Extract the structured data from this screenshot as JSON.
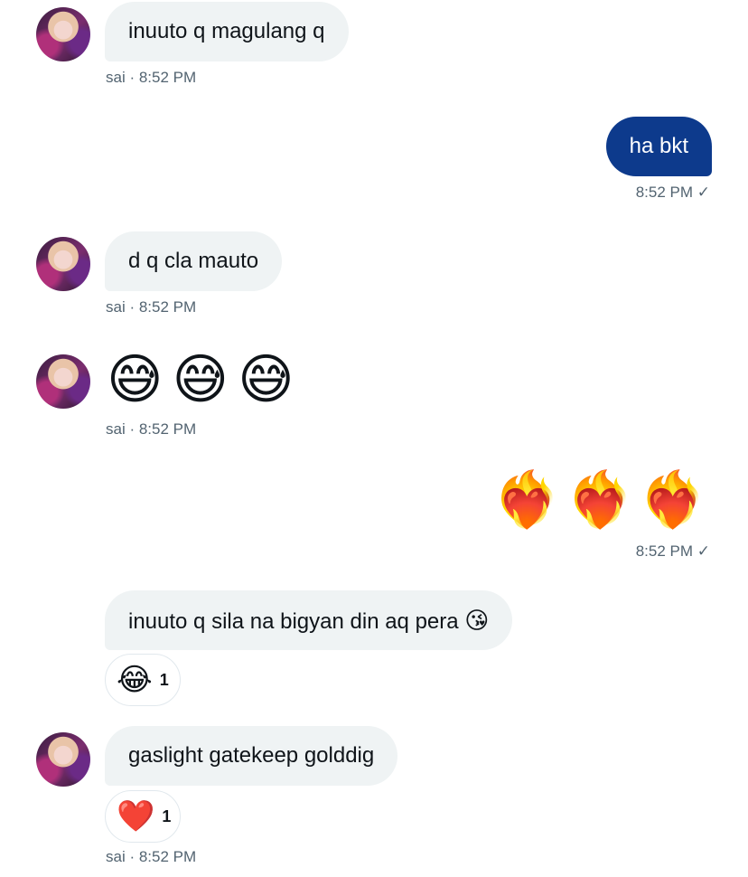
{
  "messages": [
    {
      "sender": "sai",
      "text": "inuuto q magulang q",
      "meta": "sai · 8:52 PM"
    },
    {
      "text": "ha bkt",
      "meta": "8:52 PM ✓"
    },
    {
      "sender": "sai",
      "text": "d q cla mauto",
      "meta": "sai · 8:52 PM"
    },
    {
      "sender": "sai",
      "emojis": "😅😅😅",
      "meta": "sai · 8:52 PM"
    },
    {
      "emojis": "❤️‍🔥❤️‍🔥❤️‍🔥",
      "meta": "8:52 PM ✓"
    },
    {
      "sender": "sai",
      "text": "inuuto q sila na bigyan din aq pera",
      "inline_emoji": "😘",
      "reaction": {
        "emoji": "😂",
        "count": "1"
      }
    },
    {
      "sender": "sai",
      "text": "gaslight gatekeep golddig",
      "reaction": {
        "emoji": "❤️",
        "count": "1"
      },
      "meta": "sai · 8:52 PM"
    }
  ],
  "colors": {
    "incoming_bubble": "#eff3f4",
    "outgoing_bubble": "#0d3a8c",
    "meta_text": "#536471"
  }
}
